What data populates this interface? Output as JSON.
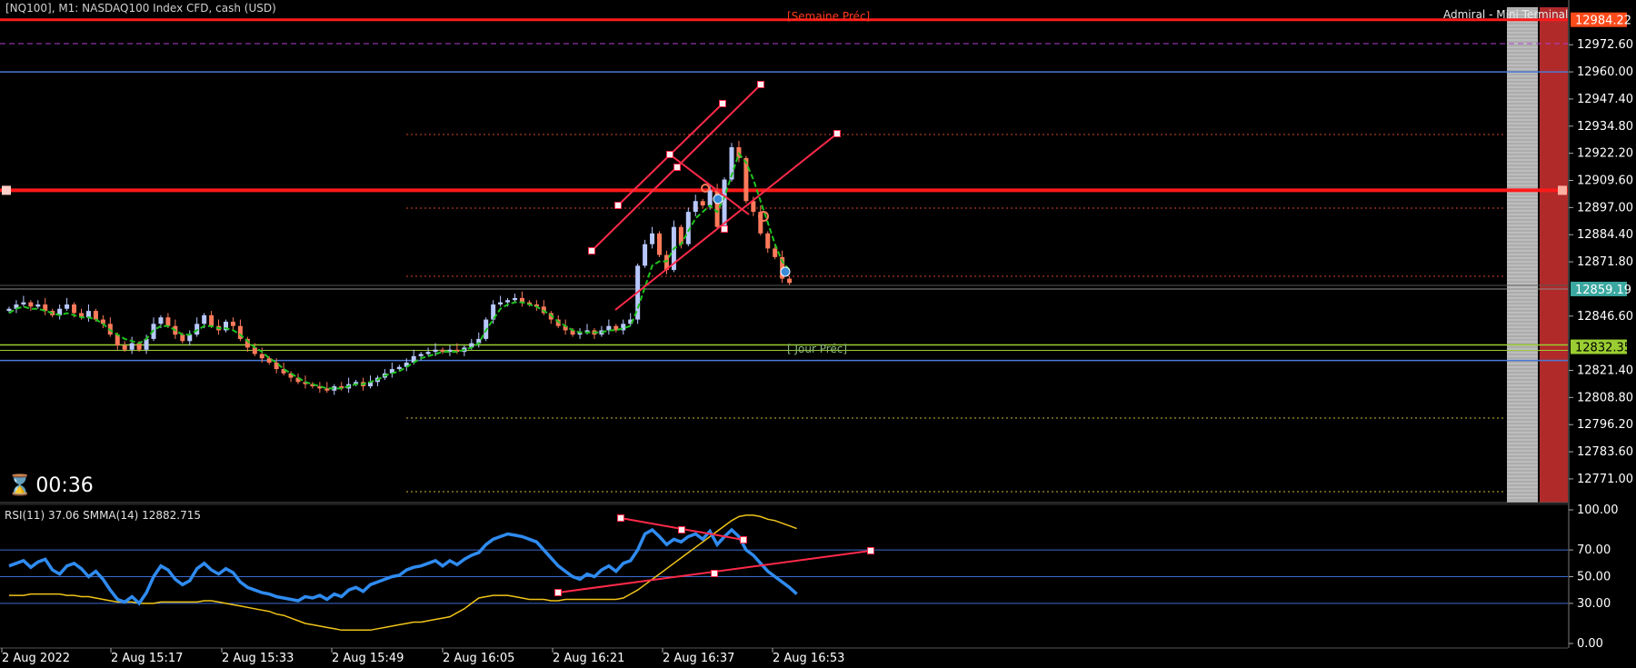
{
  "header": {
    "title": "[NQ100], M1:  NASDAQ100 Index CFD, cash (USD)",
    "terminal": "Admiral - Mini Terminal"
  },
  "timer": {
    "text": "00:36"
  },
  "annotations": {
    "semaine": "[Semaine Préc]",
    "jour": "[ Jour Préc]"
  },
  "rsi_label": "RSI(11) 37.06 SMMA(14) 12882.715",
  "colors": {
    "background": "#000000",
    "bull": "#b8c8ff",
    "bear": "#ff7a5a",
    "ma": "#1fc21f",
    "rsi": "#2f8bf0",
    "smma": "#f0c419",
    "level_red": "#ff1a1a",
    "level_blue": "#3a6ad0",
    "level_green": "#9acd32"
  },
  "chart_data": [
    {
      "type": "candlestick",
      "symbol": "NQ100",
      "timeframe": "M1",
      "ylim": [
        12760,
        12990
      ],
      "y_ticks": [
        "12972.60",
        "12960.00",
        "12947.40",
        "12934.80",
        "12922.20",
        "12909.60",
        "12897.00",
        "12884.40",
        "12871.80",
        "12846.60",
        "12821.40",
        "12808.80",
        "12796.20",
        "12783.60",
        "12771.00"
      ],
      "x_ticks": [
        "2 Aug 2022",
        "2 Aug 15:17",
        "2 Aug 15:33",
        "2 Aug 15:49",
        "2 Aug 16:05",
        "2 Aug 16:21",
        "2 Aug 16:37",
        "2 Aug 16:53"
      ],
      "price_tags": [
        {
          "value": "12984.22",
          "color": "#ff4a1a"
        },
        {
          "value": "12859.19",
          "color": "#3aa7a0"
        },
        {
          "value": "12832.35",
          "color": "#9acd32"
        }
      ],
      "closes": [
        12850,
        12852,
        12853,
        12851,
        12852,
        12849,
        12847,
        12850,
        12852,
        12848,
        12846,
        12849,
        12845,
        12843,
        12838,
        12833,
        12831,
        12834,
        12831,
        12836,
        12843,
        12846,
        12842,
        12838,
        12835,
        12838,
        12843,
        12847,
        12842,
        12840,
        12844,
        12842,
        12836,
        12832,
        12829,
        12827,
        12825,
        12822,
        12820,
        12818,
        12816,
        12815,
        12814,
        12813,
        12812,
        12814,
        12813,
        12815,
        12816,
        12814,
        12816,
        12818,
        12820,
        12822,
        12823,
        12825,
        12828,
        12829,
        12830,
        12831,
        12830,
        12831,
        12830,
        12832,
        12834,
        12836,
        12845,
        12852,
        12853,
        12854,
        12855,
        12853,
        12852,
        12851,
        12848,
        12845,
        12842,
        12840,
        12838,
        12839,
        12840,
        12838,
        12840,
        12842,
        12840,
        12843,
        12845,
        12870,
        12880,
        12885,
        12875,
        12868,
        12888,
        12880,
        12895,
        12900,
        12898,
        12905,
        12888,
        12910,
        12925,
        12920,
        12900,
        12895,
        12885,
        12878,
        12874,
        12864,
        12862
      ],
      "ma_values": [
        12848,
        12850,
        12851,
        12850,
        12850,
        12849,
        12848,
        12847,
        12848,
        12847,
        12846,
        12846,
        12845,
        12843,
        12840,
        12838,
        12836,
        12835,
        12834,
        12836,
        12840,
        12842,
        12842,
        12840,
        12838,
        12838,
        12840,
        12842,
        12842,
        12841,
        12841,
        12840,
        12838,
        12835,
        12832,
        12830,
        12827,
        12825,
        12822,
        12820,
        12818,
        12816,
        12815,
        12814,
        12813,
        12813,
        12813,
        12814,
        12815,
        12815,
        12816,
        12817,
        12819,
        12820,
        12821,
        12823,
        12825,
        12827,
        12828,
        12829,
        12830,
        12830,
        12830,
        12831,
        12832,
        12834,
        12840,
        12845,
        12850,
        12852,
        12853,
        12853,
        12852,
        12851,
        12849,
        12847,
        12844,
        12842,
        12840,
        12839,
        12839,
        12839,
        12839,
        12840,
        12840,
        12841,
        12842,
        12850,
        12860,
        12870,
        12872,
        12872,
        12878,
        12880,
        12886,
        12892,
        12895,
        12898,
        12895,
        12902,
        12912,
        12922,
        12918,
        12910,
        12900,
        12890,
        12880,
        12872,
        12868
      ],
      "levels": [
        12984.22,
        12960.0,
        12905.0,
        12859.19,
        12832.35,
        12828.5
      ]
    },
    {
      "type": "line",
      "title": "RSI(11) 37.06 SMMA(14) 12882.715",
      "ylim": [
        0,
        100
      ],
      "y_ticks": [
        "100.00",
        "70.00",
        "50.00",
        "30.00",
        "0.00"
      ],
      "levels": [
        70,
        50,
        30
      ],
      "series": [
        {
          "name": "RSI(11)",
          "values": [
            58,
            60,
            62,
            57,
            61,
            63,
            55,
            52,
            58,
            60,
            56,
            50,
            54,
            48,
            40,
            33,
            31,
            35,
            30,
            38,
            50,
            58,
            55,
            48,
            44,
            47,
            56,
            60,
            55,
            52,
            56,
            53,
            46,
            42,
            40,
            38,
            37,
            35,
            34,
            33,
            32,
            35,
            34,
            36,
            33,
            37,
            35,
            40,
            42,
            39,
            44,
            46,
            48,
            50,
            51,
            55,
            57,
            58,
            60,
            62,
            58,
            62,
            59,
            63,
            66,
            68,
            74,
            78,
            80,
            82,
            81,
            80,
            78,
            76,
            70,
            64,
            58,
            54,
            50,
            48,
            52,
            50,
            55,
            58,
            54,
            60,
            62,
            70,
            82,
            85,
            80,
            74,
            78,
            76,
            80,
            82,
            78,
            84,
            74,
            80,
            85,
            80,
            70,
            66,
            60,
            54,
            50,
            46,
            42,
            37
          ]
        },
        {
          "name": "SMMA(14)",
          "values": [
            36,
            36,
            36,
            37,
            37,
            37,
            37,
            37,
            36,
            36,
            35,
            35,
            34,
            33,
            32,
            31,
            31,
            31,
            30,
            30,
            30,
            31,
            31,
            31,
            31,
            31,
            31,
            32,
            32,
            31,
            30,
            29,
            28,
            27,
            26,
            25,
            24,
            22,
            21,
            19,
            17,
            15,
            14,
            13,
            12,
            11,
            10,
            10,
            10,
            10,
            10,
            11,
            12,
            13,
            14,
            15,
            16,
            16,
            17,
            18,
            19,
            20,
            23,
            26,
            30,
            34,
            35,
            36,
            36,
            36,
            35,
            34,
            33,
            33,
            33,
            32,
            32,
            33,
            33,
            33,
            33,
            33,
            33,
            33,
            33,
            34,
            37,
            40,
            44,
            48,
            52,
            56,
            60,
            64,
            68,
            72,
            76,
            80,
            84,
            88,
            92,
            95,
            96,
            96,
            95,
            93,
            92,
            90,
            88,
            86
          ]
        }
      ]
    }
  ]
}
